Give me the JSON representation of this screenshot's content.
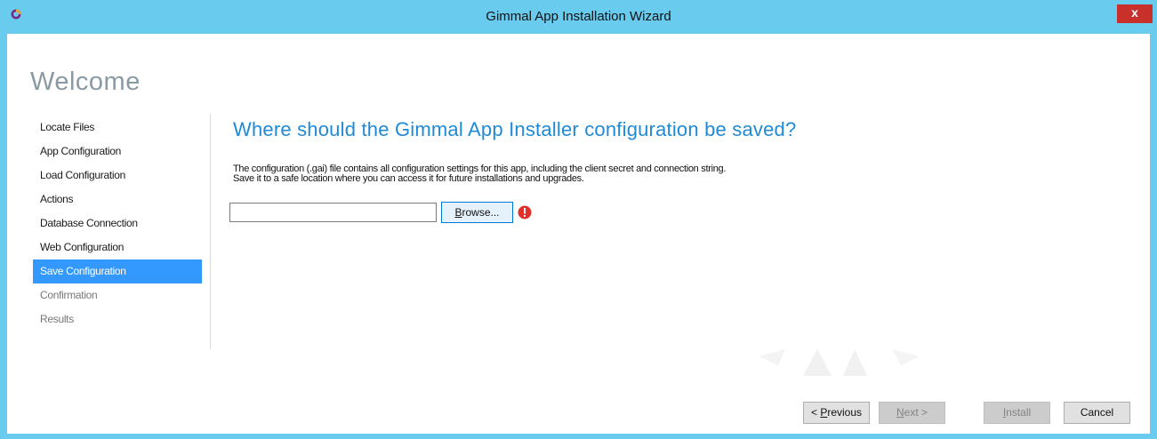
{
  "window": {
    "title": "Gimmal App Installation Wizard",
    "close_label": "x"
  },
  "page": {
    "welcome": "Welcome"
  },
  "nav": {
    "items": [
      {
        "label": "Locate Files"
      },
      {
        "label": "App Configuration"
      },
      {
        "label": "Load Configuration"
      },
      {
        "label": "Actions"
      },
      {
        "label": "Database Connection"
      },
      {
        "label": "Web Configuration"
      },
      {
        "label": "Save Configuration"
      },
      {
        "label": "Confirmation"
      },
      {
        "label": "Results"
      }
    ],
    "active": "Save Configuration"
  },
  "main": {
    "heading": "Where should the Gimmal App Installer configuration be saved?",
    "description_line1": "The configuration (.gai) file contains all configuration settings for this app, including the client secret and connection string.",
    "description_line2": "Save it to a safe location where you can access it for future installations and upgrades.",
    "path_value": "",
    "browse_label_rest": "rowse...",
    "browse_label_mnemonic": "B"
  },
  "footer": {
    "previous_prefix": "< ",
    "previous_mnemonic": "P",
    "previous_rest": "revious",
    "next_mnemonic": "N",
    "next_rest": "ext >",
    "install_mnemonic": "I",
    "install_rest": "nstall",
    "cancel_label": "Cancel"
  },
  "colors": {
    "titlebar": "#69cbee",
    "accent": "#3399ff",
    "heading": "#1f8ad6",
    "close": "#c8312b",
    "error": "#e0322b"
  },
  "icons": {
    "app": "gimmal-logo-icon",
    "validation": "error-icon",
    "close": "close-icon"
  }
}
